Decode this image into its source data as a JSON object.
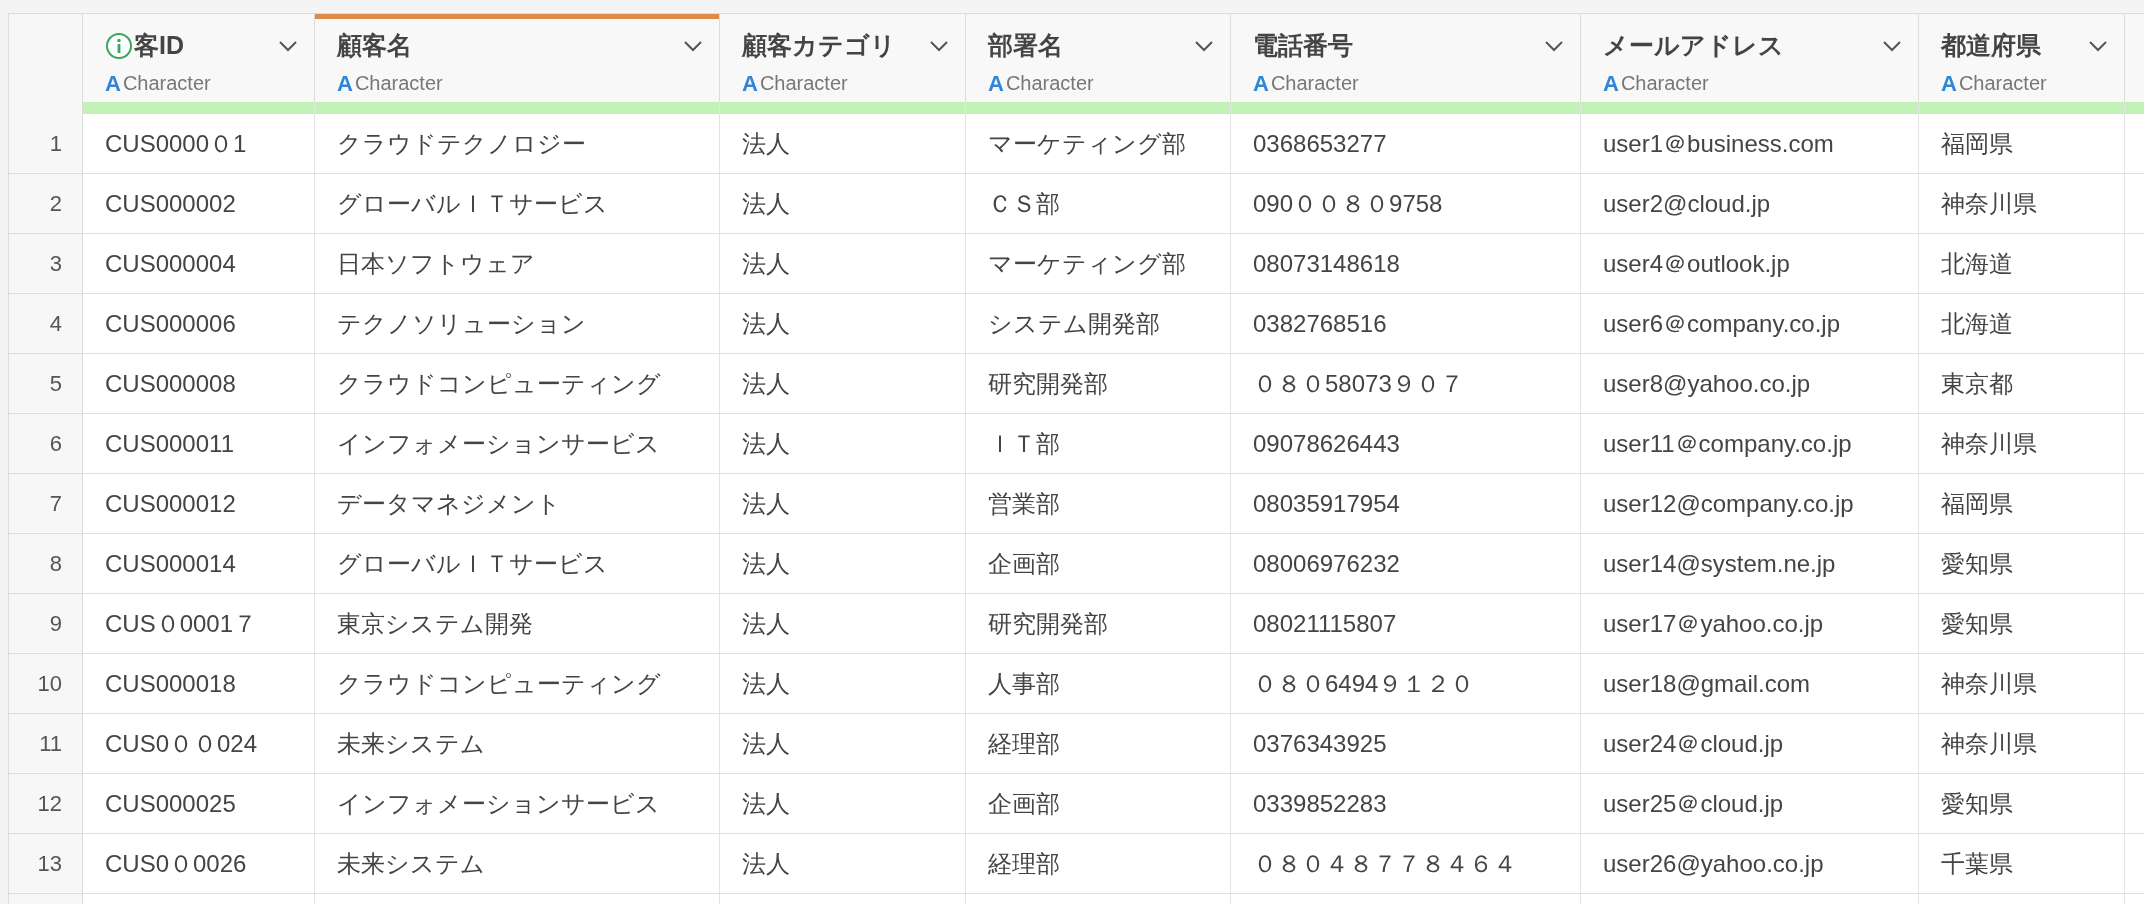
{
  "table": {
    "columns": [
      {
        "title": "客ID",
        "type_icon": "A",
        "type": "Character",
        "selected": false,
        "info": true
      },
      {
        "title": "顧客名",
        "type_icon": "A",
        "type": "Character",
        "selected": true,
        "info": false
      },
      {
        "title": "顧客カテゴリ",
        "type_icon": "A",
        "type": "Character",
        "selected": false,
        "info": false
      },
      {
        "title": "部署名",
        "type_icon": "A",
        "type": "Character",
        "selected": false,
        "info": false
      },
      {
        "title": "電話番号",
        "type_icon": "A",
        "type": "Character",
        "selected": false,
        "info": false
      },
      {
        "title": "メールアドレス",
        "type_icon": "A",
        "type": "Character",
        "selected": false,
        "info": false
      },
      {
        "title": "都道府県",
        "type_icon": "A",
        "type": "Character",
        "selected": false,
        "info": false
      }
    ],
    "rows": [
      {
        "index": "1",
        "cells": [
          "CUS0000０1",
          "クラウドテクノロジー",
          "法人",
          "マーケティング部",
          "0368653277",
          "user1＠business.com",
          "福岡県"
        ]
      },
      {
        "index": "2",
        "cells": [
          "CUS000002",
          "グローバルＩＴサービス",
          "法人",
          "ＣＳ部",
          "090００８０9758",
          "user2@cloud.jp",
          "神奈川県"
        ]
      },
      {
        "index": "3",
        "cells": [
          "CUS000004",
          "日本ソフトウェア",
          "法人",
          "マーケティング部",
          "08073148618",
          "user4＠outlook.jp",
          "北海道"
        ]
      },
      {
        "index": "4",
        "cells": [
          "CUS000006",
          "テクノソリューション",
          "法人",
          "システム開発部",
          "0382768516",
          "user6＠company.co.jp",
          "北海道"
        ]
      },
      {
        "index": "5",
        "cells": [
          "CUS000008",
          "クラウドコンピューティング",
          "法人",
          "研究開発部",
          "０８０58073９０７",
          "user8@yahoo.co.jp",
          "東京都"
        ]
      },
      {
        "index": "6",
        "cells": [
          "CUS000011",
          "インフォメーションサービス",
          "法人",
          "ＩＴ部",
          "09078626443",
          "user11＠company.co.jp",
          "神奈川県"
        ]
      },
      {
        "index": "7",
        "cells": [
          "CUS000012",
          "データマネジメント",
          "法人",
          "営業部",
          "08035917954",
          "user12@company.co.jp",
          "福岡県"
        ]
      },
      {
        "index": "8",
        "cells": [
          "CUS000014",
          "グローバルＩＴサービス",
          "法人",
          "企画部",
          "08006976232",
          "user14@system.ne.jp",
          "愛知県"
        ]
      },
      {
        "index": "9",
        "cells": [
          "CUS０0001７",
          "東京システム開発",
          "法人",
          "研究開発部",
          "08021115807",
          "user17＠yahoo.co.jp",
          "愛知県"
        ]
      },
      {
        "index": "10",
        "cells": [
          "CUS000018",
          "クラウドコンピューティング",
          "法人",
          "人事部",
          "０８０6494９１２０",
          "user18@gmail.com",
          "神奈川県"
        ]
      },
      {
        "index": "11",
        "cells": [
          "CUS0００024",
          "未来システム",
          "法人",
          "経理部",
          "0376343925",
          "user24＠cloud.jp",
          "神奈川県"
        ]
      },
      {
        "index": "12",
        "cells": [
          "CUS000025",
          "インフォメーションサービス",
          "法人",
          "企画部",
          "0339852283",
          "user25＠cloud.jp",
          "愛知県"
        ]
      },
      {
        "index": "13",
        "cells": [
          "CUS0０0026",
          "未来システム",
          "法人",
          "経理部",
          "０８０４８７７８４６４",
          "user26@yahoo.co.jp",
          "千葉県"
        ]
      }
    ]
  }
}
